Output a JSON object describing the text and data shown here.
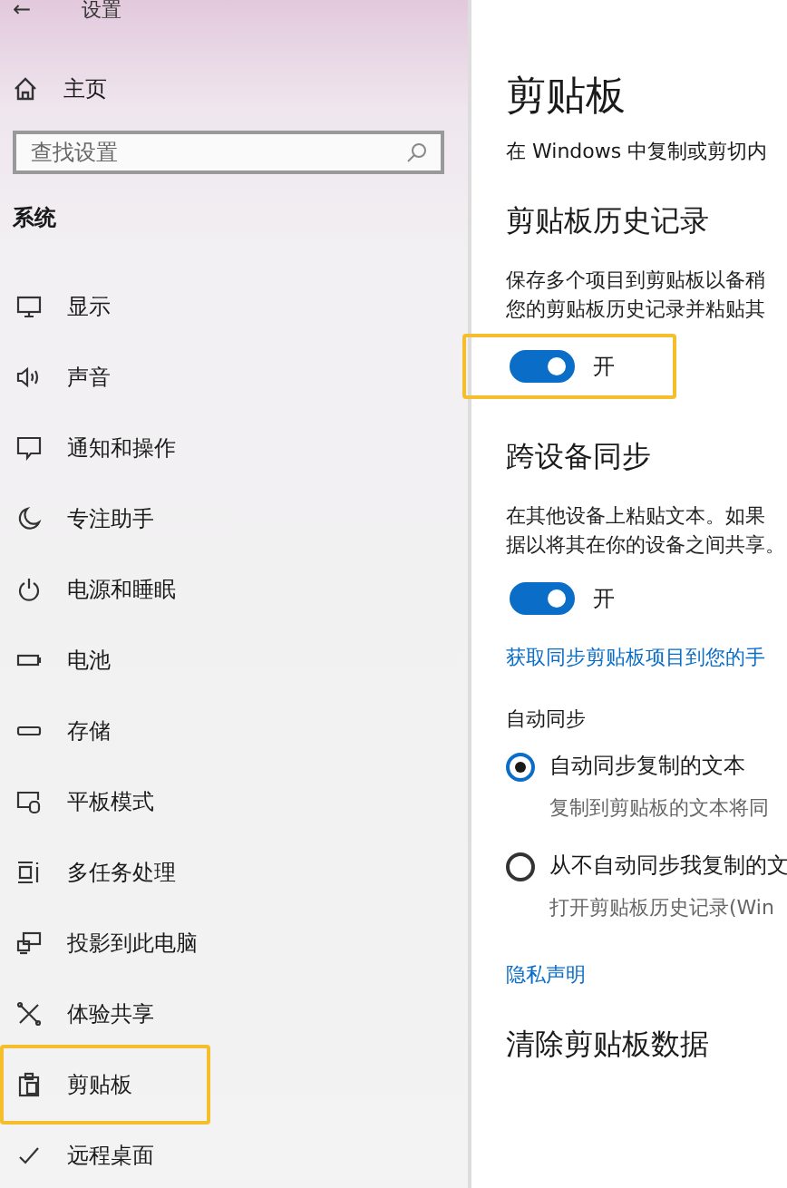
{
  "window": {
    "title": "设置",
    "back": "←"
  },
  "sidebar": {
    "home": "主页",
    "search": {
      "placeholder": "查找设置"
    },
    "section": "系统",
    "items": [
      {
        "label": "显示",
        "selected": false
      },
      {
        "label": "声音",
        "selected": false
      },
      {
        "label": "通知和操作",
        "selected": false
      },
      {
        "label": "专注助手",
        "selected": false
      },
      {
        "label": "电源和睡眠",
        "selected": false
      },
      {
        "label": "电池",
        "selected": false
      },
      {
        "label": "存储",
        "selected": false
      },
      {
        "label": "平板模式",
        "selected": false
      },
      {
        "label": "多任务处理",
        "selected": false
      },
      {
        "label": "投影到此电脑",
        "selected": false
      },
      {
        "label": "体验共享",
        "selected": false
      },
      {
        "label": "剪贴板",
        "selected": true
      },
      {
        "label": "远程桌面",
        "selected": false
      }
    ]
  },
  "content": {
    "title": "剪贴板",
    "intro": "在 Windows 中复制或剪切内",
    "history": {
      "heading": "剪贴板历史记录",
      "lines": [
        "保存多个项目到剪贴板以备稍",
        "您的剪贴板历史记录并粘贴其"
      ],
      "toggle": {
        "on": true,
        "label": "开",
        "highlighted": true
      }
    },
    "sync": {
      "heading": "跨设备同步",
      "lines": [
        "在其他设备上粘贴文本。如果",
        "据以将其在你的设备之间共享。"
      ],
      "toggle": {
        "on": true,
        "label": "开"
      },
      "link": "获取同步剪贴板项目到您的手",
      "auto_label": "自动同步",
      "options": [
        {
          "label": "自动同步复制的文本",
          "hint": "复制到剪贴板的文本将同",
          "selected": true
        },
        {
          "label": "从不自动同步我复制的文",
          "hint": "打开剪贴板历史记录(Win",
          "selected": false
        }
      ]
    },
    "privacy_link": "隐私声明",
    "clear_heading": "清除剪贴板数据"
  }
}
